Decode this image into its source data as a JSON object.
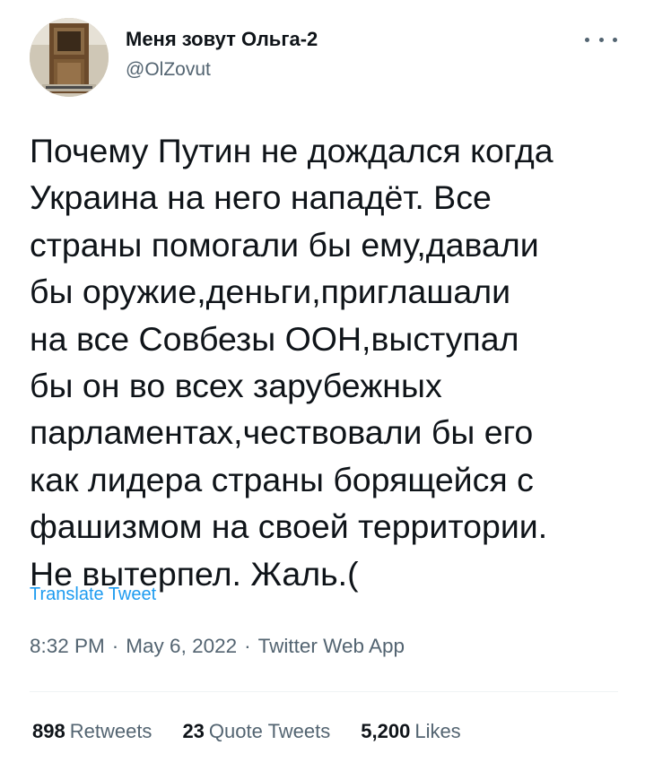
{
  "author": {
    "display_name": "Меня зовут Ольга-2",
    "handle": "@OlZovut"
  },
  "tweet": {
    "text": "Почему Путин не дождался когда\nУкраина на него нападёт. Все\nстраны помогали бы ему,давали\nбы оружие,деньги,приглашали\nна все Совбезы ООН,выступал\nбы он во всех зарубежных\nпарламентах,чествовали бы его\nкак лидера страны борящейся с\nфашизмом на своей территории.\nНе вытерпел. Жаль.(",
    "translate_label": "Translate Tweet",
    "time": "8:32 PM",
    "date": "May 6, 2022",
    "source": "Twitter Web App",
    "separator": "·"
  },
  "stats": {
    "retweets_count": "898",
    "retweets_label": "Retweets",
    "quotes_count": "23",
    "quotes_label": "Quote Tweets",
    "likes_count": "5,200",
    "likes_label": "Likes"
  },
  "colors": {
    "text": "#0f1419",
    "secondary": "#536471",
    "link": "#1d9bf0",
    "divider": "#eff3f4"
  },
  "icons": {
    "more": "more-horizontal-icon"
  }
}
